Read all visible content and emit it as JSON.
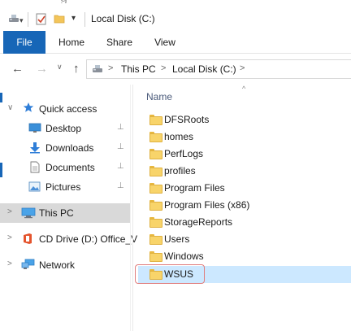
{
  "window": {
    "title": "Local Disk (C:)",
    "title_fragment": "g"
  },
  "ribbon": {
    "tabs": [
      {
        "label": "File",
        "active": true
      },
      {
        "label": "Home"
      },
      {
        "label": "Share"
      },
      {
        "label": "View"
      }
    ]
  },
  "address": {
    "breadcrumbs": [
      "This PC",
      "Local Disk (C:)"
    ],
    "separators": [
      ">",
      ">",
      ">"
    ]
  },
  "navigation_pane": {
    "items": [
      {
        "label": "Quick access",
        "icon": "star-icon",
        "expand": "v"
      },
      {
        "label": "Desktop",
        "icon": "desktop-icon",
        "pinned": true
      },
      {
        "label": "Downloads",
        "icon": "downloads-icon",
        "pinned": true
      },
      {
        "label": "Documents",
        "icon": "documents-icon",
        "pinned": true
      },
      {
        "label": "Pictures",
        "icon": "pictures-icon",
        "pinned": true
      },
      {
        "label": "This PC",
        "icon": "computer-icon",
        "expand": ">",
        "selected": true
      },
      {
        "label": "CD Drive (D:) Office_V",
        "icon": "office-drive-icon",
        "expand": ">"
      },
      {
        "label": "Network",
        "icon": "network-icon",
        "expand": ">"
      }
    ],
    "pin_glyph": "📌"
  },
  "content": {
    "column_header": "Name",
    "sort_indicator": "^",
    "files": [
      {
        "name": "DFSRoots"
      },
      {
        "name": "homes"
      },
      {
        "name": "PerfLogs"
      },
      {
        "name": "profiles"
      },
      {
        "name": "Program Files"
      },
      {
        "name": "Program Files (x86)"
      },
      {
        "name": "StorageReports"
      },
      {
        "name": "Users"
      },
      {
        "name": "Windows"
      },
      {
        "name": "WSUS",
        "selected": true
      }
    ]
  },
  "colors": {
    "accent": "#1766b7",
    "selection": "#cce8ff",
    "nav_selected": "#d9d9d9",
    "highlight_box": "#e07d7d",
    "folder": "#f8d46a"
  }
}
